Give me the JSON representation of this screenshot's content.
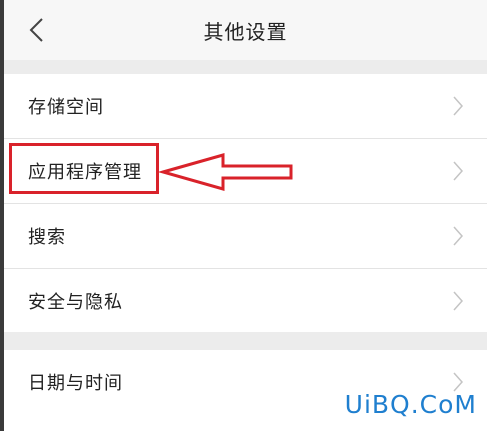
{
  "header": {
    "title": "其他设置",
    "back_icon": "chevron-left-icon"
  },
  "settings": {
    "items": [
      {
        "label": "存储空间"
      },
      {
        "label": "应用程序管理",
        "highlighted": true
      },
      {
        "label": "搜索"
      },
      {
        "label": "安全与隐私"
      },
      {
        "label": "日期与时间"
      }
    ]
  },
  "annotation": {
    "highlight_color": "#d9222a",
    "arrow_direction": "left"
  },
  "watermark": "UiBQ.CoM",
  "colors": {
    "background": "#efeff0",
    "row_background": "#ffffff",
    "accent_watermark": "#1f7fcf"
  }
}
